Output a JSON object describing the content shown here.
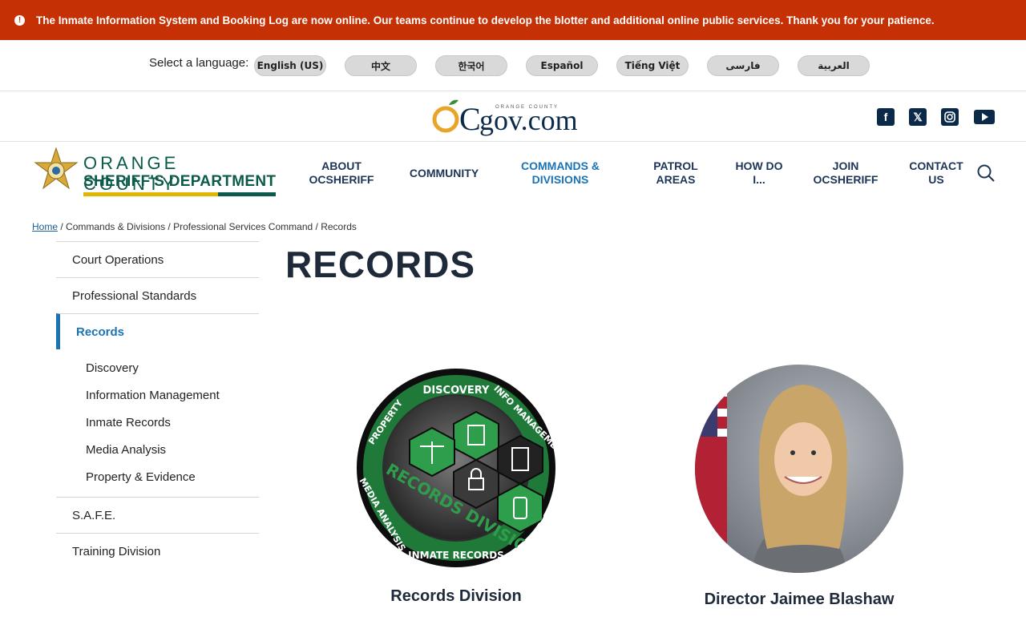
{
  "alert": {
    "text": "The Inmate Information System and Booking Log are now online. Our teams continue to develop the blotter and additional online public services. Thank you for your patience."
  },
  "languages": {
    "label": "Select a language:",
    "options": [
      "English (US)",
      "中文",
      "한국어",
      "Español",
      "Tiếng Việt",
      "فارسی",
      "العربية"
    ]
  },
  "gov_logo": {
    "brand": "OCgov.com",
    "tagline": "ORANGE COUNTY"
  },
  "social": [
    "facebook-icon",
    "x-icon",
    "instagram-icon",
    "youtube-icon"
  ],
  "sheriff": {
    "line1": "ORANGE COUNTY",
    "line2": "SHERIFF'S DEPARTMENT"
  },
  "nav": [
    {
      "line1": "ABOUT",
      "line2": "OCSHERIFF"
    },
    {
      "line1": "COMMUNITY",
      "line2": ""
    },
    {
      "line1": "COMMANDS &",
      "line2": "DIVISIONS"
    },
    {
      "line1": "PATROL",
      "line2": "AREAS"
    },
    {
      "line1": "HOW DO",
      "line2": "I..."
    },
    {
      "line1": "JOIN",
      "line2": "OCSHERIFF"
    },
    {
      "line1": "CONTACT",
      "line2": "US"
    }
  ],
  "breadcrumb": {
    "home": "Home",
    "items": [
      "Commands & Divisions",
      "Professional Services Command",
      "Records"
    ]
  },
  "sidebar": {
    "items": [
      "Court Operations",
      "Professional Standards",
      "Records",
      "S.A.F.E.",
      "Training Division"
    ],
    "sub": [
      "Discovery",
      "Information Management",
      "Inmate Records",
      "Media Analysis",
      "Property & Evidence"
    ]
  },
  "page": {
    "title": "RECORDS"
  },
  "badge_ring": [
    "DISCOVERY",
    "INFO MANAGEMENT",
    "INMATE RECORDS",
    "MEDIA ANALYSIS",
    "PROPERTY"
  ],
  "badge_center": "RECORDS DIVISION",
  "cards": [
    {
      "caption": "Records Division"
    },
    {
      "caption": "Director Jaimee Blashaw"
    }
  ],
  "colors": {
    "alert": "#c53105",
    "navy": "#1d3557",
    "accent": "#1a73b5",
    "green": "#0b5a4a",
    "gold": "#e2b500"
  }
}
